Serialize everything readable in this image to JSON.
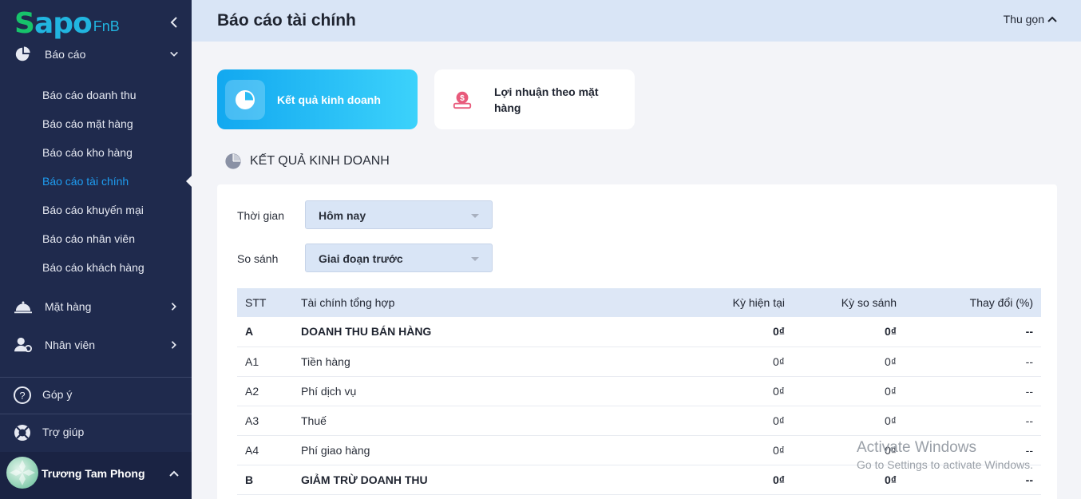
{
  "app": {
    "logo_main": "Sapo",
    "logo_sub": "FnB"
  },
  "sidebar": {
    "group_reports": {
      "label": "Báo cáo"
    },
    "report_items": [
      {
        "label": "Báo cáo doanh thu"
      },
      {
        "label": "Báo cáo mặt hàng"
      },
      {
        "label": "Báo cáo kho hàng"
      },
      {
        "label": "Báo cáo tài chính",
        "active": true
      },
      {
        "label": "Báo cáo khuyến mại"
      },
      {
        "label": "Báo cáo nhân viên"
      },
      {
        "label": "Báo cáo khách hàng"
      }
    ],
    "group_items": {
      "label": "Mặt hàng"
    },
    "group_staff": {
      "label": "Nhân viên"
    },
    "feedback": {
      "label": "Góp ý"
    },
    "help": {
      "label": "Trợ giúp"
    },
    "user": {
      "name": "Trương Tam Phong"
    }
  },
  "header": {
    "title": "Báo cáo tài chính",
    "collapse_label": "Thu gọn"
  },
  "cards": [
    {
      "label": "Kết quả kinh doanh",
      "active": true
    },
    {
      "label": "Lợi nhuận theo mặt hàng",
      "active": false
    }
  ],
  "section": {
    "title": "KẾT QUẢ KINH DOANH"
  },
  "filters": {
    "time": {
      "label": "Thời gian",
      "value": "Hôm nay"
    },
    "compare": {
      "label": "So sánh",
      "value": "Giai đoạn trước"
    }
  },
  "table": {
    "columns": [
      "STT",
      "Tài chính tổng hợp",
      "Kỳ hiện tại",
      "Kỳ so sánh",
      "Thay đổi (%)"
    ],
    "rows": [
      {
        "stt": "A",
        "name": "DOANH THU BÁN HÀNG",
        "current": "0₫",
        "compare": "0₫",
        "change": "--"
      },
      {
        "stt": "A1",
        "name": "Tiền hàng",
        "current": "0₫",
        "compare": "0₫",
        "change": "--"
      },
      {
        "stt": "A2",
        "name": "Phí dịch vụ",
        "current": "0₫",
        "compare": "0₫",
        "change": "--"
      },
      {
        "stt": "A3",
        "name": "Thuế",
        "current": "0₫",
        "compare": "0₫",
        "change": "--"
      },
      {
        "stt": "A4",
        "name": "Phí giao hàng",
        "current": "0₫",
        "compare": "0₫",
        "change": "--"
      },
      {
        "stt": "B",
        "name": "GIẢM TRỪ DOANH THU",
        "current": "0₫",
        "compare": "0₫",
        "change": "--"
      }
    ]
  },
  "watermark": {
    "line1": "Activate Windows",
    "line2": "Go to Settings to activate Windows."
  },
  "colors": {
    "sidebar_bg": "#1f2a4d",
    "accent": "#1e9cf0",
    "header_bg": "#d9e5f6"
  }
}
